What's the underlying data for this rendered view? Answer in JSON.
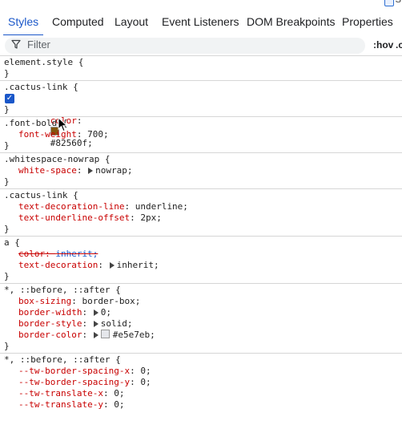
{
  "top_strip": {
    "text": "S"
  },
  "tabs": [
    {
      "label": "Styles",
      "active": true
    },
    {
      "label": "Computed",
      "active": false
    },
    {
      "label": "Layout",
      "active": false
    },
    {
      "label": "Event Listeners",
      "active": false
    },
    {
      "label": "DOM Breakpoints",
      "active": false
    },
    {
      "label": "Properties",
      "active": false
    }
  ],
  "filter": {
    "placeholder": "Filter",
    "hov_label": ":hov",
    "cls_label": ".c"
  },
  "rules": {
    "r0": {
      "selector": "element.style {",
      "close": "}"
    },
    "r1": {
      "selector": ".cactus-link {",
      "close": "}",
      "p0": {
        "name": "color",
        "value": "#82560f;",
        "swatch": "#82560f",
        "checked": true
      }
    },
    "r2": {
      "selector": ".font-bold {",
      "close": "}",
      "p0": {
        "name": "font-weight",
        "value": "700;"
      }
    },
    "r3": {
      "selector": ".whitespace-nowrap {",
      "close": "}",
      "p0": {
        "name": "white-space",
        "value": "nowrap;"
      }
    },
    "r4": {
      "selector": ".cactus-link {",
      "close": "}",
      "p0": {
        "name": "text-decoration-line",
        "value": "underline;"
      },
      "p1": {
        "name": "text-underline-offset",
        "value": "2px;"
      }
    },
    "r5": {
      "selector": "a {",
      "close": "}",
      "p0": {
        "name": "color",
        "value": "inherit;",
        "overridden": true
      },
      "p1": {
        "name": "text-decoration",
        "value": "inherit;"
      }
    },
    "r6": {
      "selector": "*, ::before, ::after {",
      "close": "}",
      "p0": {
        "name": "box-sizing",
        "value": "border-box;"
      },
      "p1": {
        "name": "border-width",
        "value": "0;"
      },
      "p2": {
        "name": "border-style",
        "value": "solid;"
      },
      "p3": {
        "name": "border-color",
        "value": "#e5e7eb;",
        "swatch": "#e5e7eb"
      }
    },
    "r7": {
      "selector": "*, ::before, ::after {",
      "p0": {
        "name": "--tw-border-spacing-x",
        "value": "0;"
      },
      "p1": {
        "name": "--tw-border-spacing-y",
        "value": "0;"
      },
      "p2": {
        "name": "--tw-translate-x",
        "value": "0;"
      },
      "p3": {
        "name": "--tw-translate-y",
        "value": "0;"
      }
    }
  },
  "colors": {
    "accent": "#1a57c9",
    "property_name": "#c80000",
    "divider": "#d6d6d6"
  }
}
